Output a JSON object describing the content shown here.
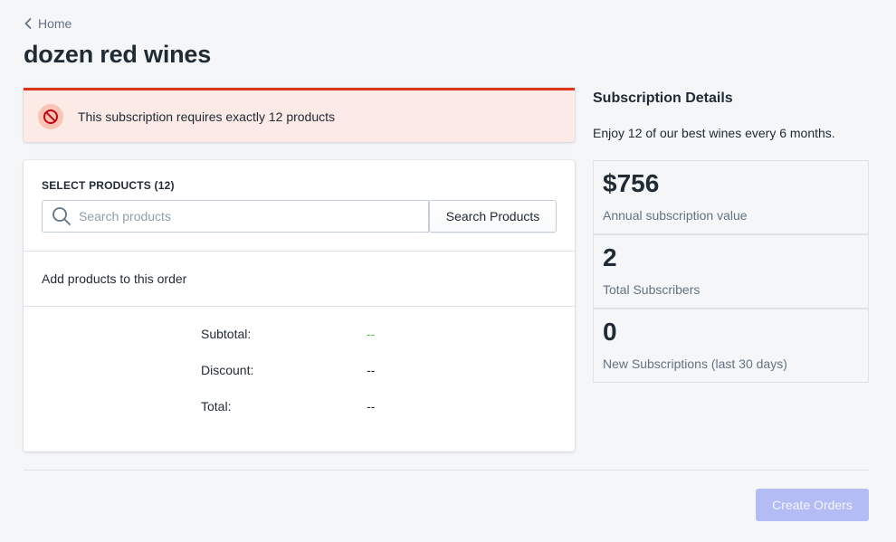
{
  "breadcrumb": {
    "label": "Home"
  },
  "page": {
    "title": "dozen red wines"
  },
  "banner": {
    "message": "This subscription requires exactly 12 products",
    "icon": "circle-slash-icon",
    "accent_color": "#de3618"
  },
  "products_card": {
    "label": "SELECT PRODUCTS (12)",
    "search_placeholder": "Search products",
    "search_value": "",
    "search_button": "Search Products",
    "empty_text": "Add products to this order"
  },
  "totals": {
    "subtotal_label": "Subtotal:",
    "subtotal_value": "--",
    "discount_label": "Discount:",
    "discount_value": "--",
    "total_label": "Total:",
    "total_value": "--"
  },
  "details": {
    "title": "Subscription Details",
    "description": "Enjoy 12 of our best wines every 6 months.",
    "stats": [
      {
        "value": "$756",
        "label": "Annual subscription value"
      },
      {
        "value": "2",
        "label": "Total Subscribers"
      },
      {
        "value": "0",
        "label": "New Subscriptions (last 30 days)"
      }
    ]
  },
  "footer": {
    "create_button": "Create Orders",
    "button_color": "#b3bcf5"
  }
}
